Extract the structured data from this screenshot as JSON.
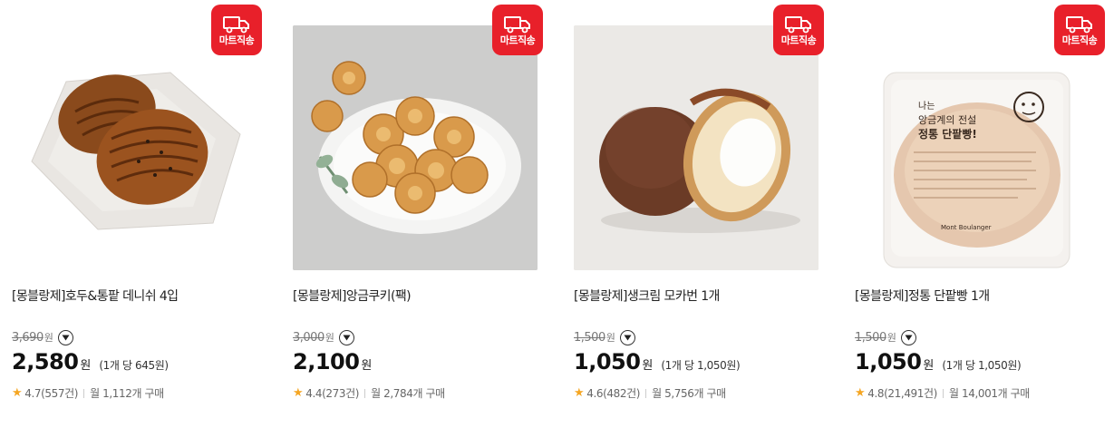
{
  "badge_label": "마트직송",
  "colors": {
    "badge_red": "#e8202a",
    "star": "#f5a623"
  },
  "products": [
    {
      "title": "[몽블랑제]호두&통팥 데니쉬 4입",
      "original_price": "3,690",
      "original_unit": "원",
      "price": "2,580",
      "price_unit": "원",
      "unit_price": "(1개 당 645원)",
      "rating": "4.7(557건)",
      "monthly": "월 1,112개 구매"
    },
    {
      "title": "[몽블랑제]앙금쿠키(팩)",
      "original_price": "3,000",
      "original_unit": "원",
      "price": "2,100",
      "price_unit": "원",
      "unit_price": "",
      "rating": "4.4(273건)",
      "monthly": "월 2,784개 구매"
    },
    {
      "title": "[몽블랑제]생크림 모카번 1개",
      "original_price": "1,500",
      "original_unit": "원",
      "price": "1,050",
      "price_unit": "원",
      "unit_price": "(1개 당 1,050원)",
      "rating": "4.6(482건)",
      "monthly": "월 5,756개 구매"
    },
    {
      "title": "[몽블랑제]정통 단팥빵 1개",
      "original_price": "1,500",
      "original_unit": "원",
      "price": "1,050",
      "price_unit": "원",
      "unit_price": "(1개 당 1,050원)",
      "rating": "4.8(21,491건)",
      "monthly": "월 14,001개 구매"
    }
  ],
  "package_text": {
    "line1": "나는",
    "line2": "앙금계의 전설",
    "line3": "정통 단팥빵!",
    "brand": "Mont Boulanger"
  }
}
